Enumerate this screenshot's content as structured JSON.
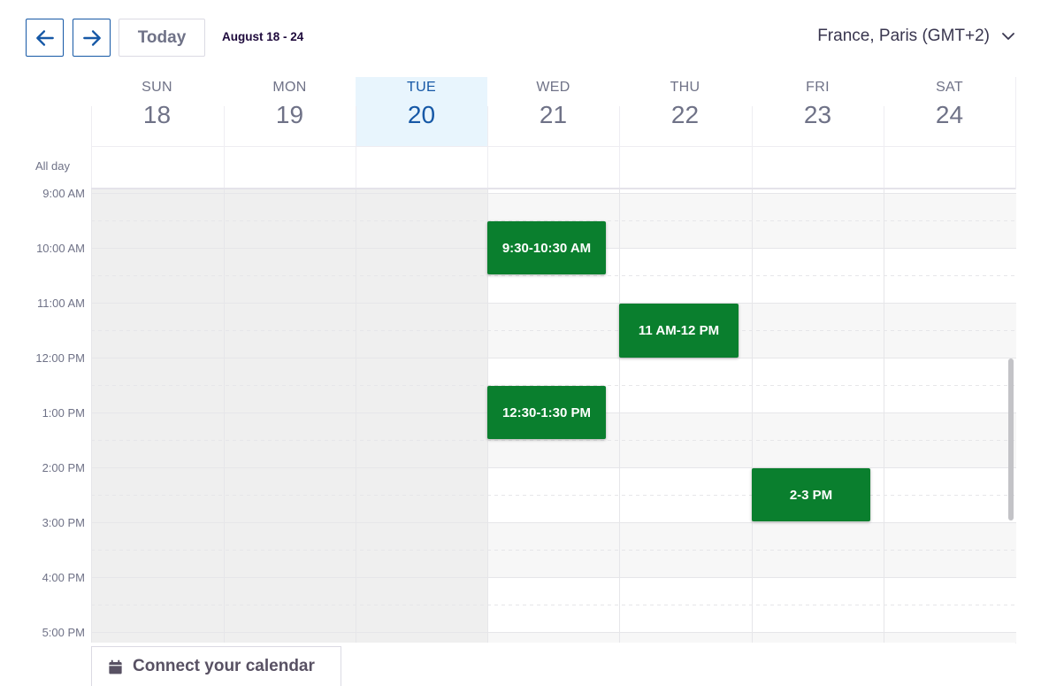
{
  "toolbar": {
    "today_label": "Today",
    "week_range": "August 18 - 24",
    "timezone": "France, Paris (GMT+2)"
  },
  "days": [
    {
      "dow": "SUN",
      "date": "18"
    },
    {
      "dow": "MON",
      "date": "19"
    },
    {
      "dow": "TUE",
      "date": "20",
      "is_today": true
    },
    {
      "dow": "WED",
      "date": "21"
    },
    {
      "dow": "THU",
      "date": "22"
    },
    {
      "dow": "FRI",
      "date": "23"
    },
    {
      "dow": "SAT",
      "date": "24"
    }
  ],
  "allday_label": "All day",
  "time_labels": [
    "9:00 AM",
    "10:00 AM",
    "11:00 AM",
    "12:00 PM",
    "1:00 PM",
    "2:00 PM",
    "3:00 PM",
    "4:00 PM",
    "5:00 PM"
  ],
  "events": [
    {
      "day": "WED",
      "label": "9:30-10:30 AM"
    },
    {
      "day": "THU",
      "label": "11 AM-12 PM"
    },
    {
      "day": "WED",
      "label": "12:30-1:30 PM"
    },
    {
      "day": "FRI",
      "label": "2-3 PM"
    }
  ],
  "connect_calendar_label": "Connect your calendar",
  "colors": {
    "accent": "#1658a6",
    "today_bg": "#e8f5fd",
    "event_bg": "#0a7f2e",
    "past_bg": "#efefef"
  },
  "icons": {
    "prev": "arrow-left-icon",
    "next": "arrow-right-icon",
    "timezone_dropdown": "chevron-down-icon",
    "connect": "calendar-icon"
  }
}
